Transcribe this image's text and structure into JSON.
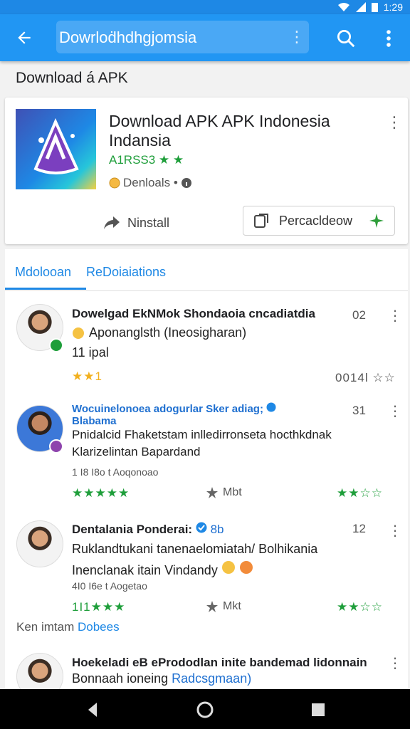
{
  "status": {
    "time": "1:29",
    "icons": [
      "wifi-icon",
      "signal-icon",
      "battery-icon"
    ]
  },
  "appbar": {
    "search_value": "Dowrloḋhdhgjomsia",
    "search_dots": "⋮"
  },
  "section_title": "Download á APK",
  "app": {
    "title": "Download APK APK Indonesia Indansia",
    "rating": "A1RSS3 ★ ★",
    "meta": "Denloals •",
    "install_label": "Ninstall",
    "preview_label": "Percacldeow"
  },
  "tabs": [
    {
      "label": "Mdolooan"
    },
    {
      "label": "ReDoiaiations"
    }
  ],
  "reviews": [
    {
      "name": "Dowelgad EkNMok Shondaoia cncadiatdia",
      "count": "02",
      "line1": "Aponanglsth (Ineosigharan)",
      "line2": "11 ipal",
      "stars_left": "★★1",
      "stars_right": "0014l ☆☆"
    },
    {
      "name": "Wocuinelonoea adogurlar Sker adiag;",
      "name2": "Blabama",
      "count": "31",
      "line1": "Pnidalcid Fhaketstam  inlledirronseta hocthkdnak",
      "line2": "Klarizelintan Bapardand",
      "sub": "1 I8 I8o t Aoqonoao",
      "stars_left": "★★★★★",
      "mid": "Mbt",
      "stars_right": "★★☆☆"
    },
    {
      "name": "Dentalania Ponderai:",
      "name_suffix": "8b",
      "count": "12",
      "line1": "Ruklandtukani tanenaelomiatah/ Bolhikania",
      "line2": "Inenclanak itain  Vindandy",
      "sub": "4I0 I6e t Aogetao",
      "stars_left": "1I1★★★",
      "mid": "Mkt",
      "stars_right": "★★☆☆"
    }
  ],
  "footer": {
    "prefix": "Ken imtam",
    "link": "Dobees"
  },
  "last_review": {
    "name": "Hoekeladi eB ePrododlan inite bandemad lidonnain",
    "line1": "Bonnaah ioneing",
    "line1_link": "Radcsgmaan)"
  },
  "colors": {
    "primary": "#2196f3",
    "accent": "#1e88e5",
    "star_gold": "#f2b01e",
    "star_green": "#1e9e3a"
  }
}
